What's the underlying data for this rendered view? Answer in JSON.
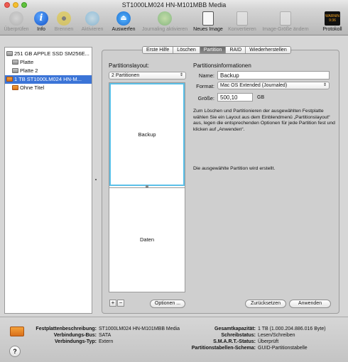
{
  "window": {
    "title": "ST1000LM024 HN-M101MBB Media"
  },
  "toolbar": {
    "items": [
      {
        "label": "Überprüfen",
        "icon": "verify-icon",
        "enabled": false
      },
      {
        "label": "Info",
        "icon": "info-icon",
        "enabled": true
      },
      {
        "label": "Brennen",
        "icon": "burn-icon",
        "enabled": false
      },
      {
        "label": "Aktivieren",
        "icon": "mount-icon",
        "enabled": false
      },
      {
        "label": "Auswerfen",
        "icon": "eject-icon",
        "enabled": true
      },
      {
        "label": "Journaling aktivieren",
        "icon": "journal-icon",
        "enabled": false
      },
      {
        "label": "Neues Image",
        "icon": "new-image-icon",
        "enabled": true
      },
      {
        "label": "Konvertieren",
        "icon": "convert-icon",
        "enabled": false
      },
      {
        "label": "Image-Größe ändern",
        "icon": "resize-image-icon",
        "enabled": false
      },
      {
        "label": "Protokoll",
        "icon": "log-icon",
        "enabled": true,
        "badge": "WARNIN 9:36"
      }
    ]
  },
  "sidebar": {
    "items": [
      {
        "label": "251 GB APPLE SSD SM256E...",
        "icon": "gray-disk-icon",
        "selected": false
      },
      {
        "label": "Platte",
        "icon": "gray-disk-icon",
        "selected": false
      },
      {
        "label": "Platte 2",
        "icon": "gray-disk-icon",
        "selected": false
      },
      {
        "label": "1 TB ST1000LM024 HN-M...",
        "icon": "orange-disk-icon",
        "selected": true
      },
      {
        "label": "Ohne Titel",
        "icon": "orange-disk-icon",
        "selected": false
      }
    ]
  },
  "tabs": [
    "Erste Hilfe",
    "Löschen",
    "Partition",
    "RAID",
    "Wiederherstellen"
  ],
  "active_tab": "Partition",
  "layout_section": {
    "heading": "Partitionslayout:",
    "selected_layout": "2 Partitionen",
    "partitions": [
      "Backup",
      "Daten"
    ]
  },
  "info_section": {
    "heading": "Partitionsinformationen",
    "name_label": "Name:",
    "name_value": "Backup",
    "format_label": "Format:",
    "format_value": "Mac OS Extended (Journaled)",
    "size_label": "Größe:",
    "size_value": "500,10",
    "size_unit": "GB",
    "description": "Zum Löschen und Partitionieren der ausgewählten Festplatte wählen Sie ein Layout aus dem Einblendmenü „Partitionslayout“ aus, legen die entsprechenden Optionen für jede Partition fest und klicken auf „Anwenden“.",
    "status": "Die ausgewählte Partition wird erstellt."
  },
  "buttons": {
    "add": "+",
    "remove": "−",
    "options": "Optionen ...",
    "revert": "Zurücksetzen",
    "apply": "Anwenden"
  },
  "footer": {
    "disk_desc_label": "Festplattenbeschreibung:",
    "disk_desc_value": "ST1000LM024 HN-M101MBB Media",
    "bus_label": "Verbindungs-Bus:",
    "bus_value": "SATA",
    "type_label": "Verbindungs-Typ:",
    "type_value": "Extern",
    "capacity_label": "Gesamtkapazität:",
    "capacity_value": "1 TB (1.000.204.886.016 Byte)",
    "write_label": "Schreibstatus:",
    "write_value": "Lesen/Schreiben",
    "smart_label": "S.M.A.R.T.-Status:",
    "smart_value": "Überprüft",
    "scheme_label": "Partitionstabellen-Schema:",
    "scheme_value": "GUID-Partitionstabelle",
    "help": "?"
  },
  "colors": {
    "selection": "#3b74d7",
    "partition_highlight": "#5bc0e8"
  }
}
